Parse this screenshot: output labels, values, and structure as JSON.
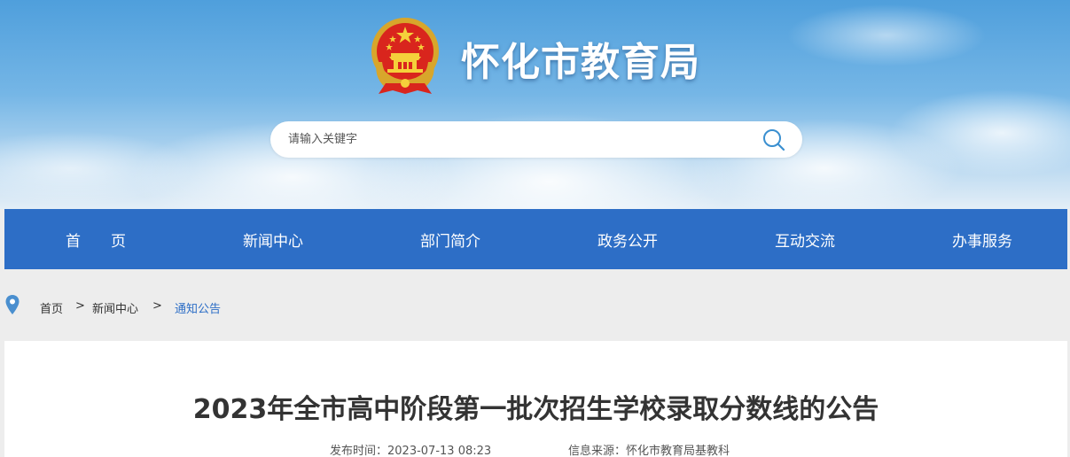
{
  "header": {
    "site_title": "怀化市教育局",
    "search": {
      "placeholder": "请输入关键字"
    }
  },
  "icons": {
    "emblem": "national-emblem",
    "search": "search-icon",
    "location": "location-pin-icon"
  },
  "nav": {
    "items": [
      {
        "label": "首　　页"
      },
      {
        "label": "新闻中心"
      },
      {
        "label": "部门简介"
      },
      {
        "label": "政务公开"
      },
      {
        "label": "互动交流"
      },
      {
        "label": "办事服务"
      }
    ]
  },
  "breadcrumb": {
    "items": [
      "首页",
      "新闻中心",
      "通知公告"
    ],
    "separator": ">"
  },
  "article": {
    "title": "2023年全市高中阶段第一批次招生学校录取分数线的公告",
    "publish_time_label": "发布时间：",
    "publish_time": "2023-07-13 08:23",
    "source_label": "信息来源：",
    "source": "怀化市教育局基教科"
  },
  "colors": {
    "nav_bg": "#2d6ec6",
    "accent": "#2d6ec6",
    "title_text": "#333333"
  }
}
